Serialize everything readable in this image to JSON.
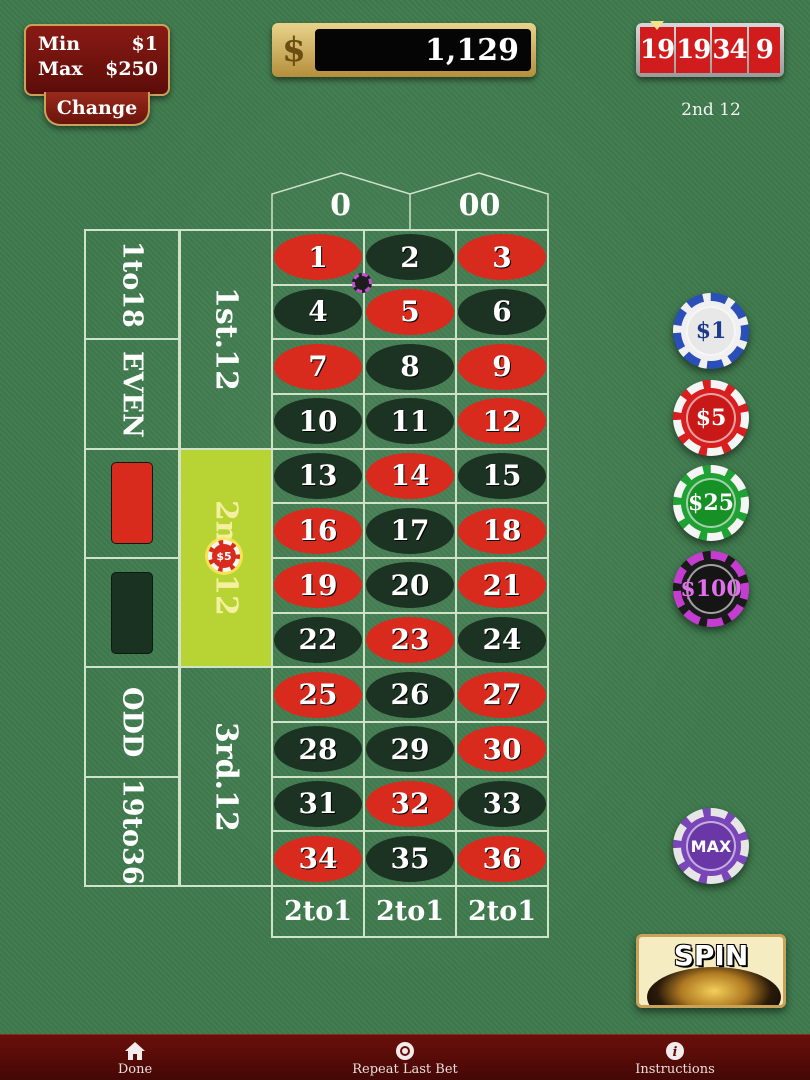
{
  "limits": {
    "min_label": "Min",
    "min_value": "$1",
    "max_label": "Max",
    "max_value": "$250",
    "change_label": "Change"
  },
  "balance": {
    "symbol": "$",
    "amount": "1,129"
  },
  "history": {
    "results": [
      "19",
      "19",
      "34",
      "9"
    ],
    "last_bet": "2nd 12"
  },
  "table": {
    "zero": "0",
    "double_zero": "00",
    "numbers": [
      {
        "n": "1",
        "c": "red"
      },
      {
        "n": "2",
        "c": "black"
      },
      {
        "n": "3",
        "c": "red"
      },
      {
        "n": "4",
        "c": "black"
      },
      {
        "n": "5",
        "c": "red"
      },
      {
        "n": "6",
        "c": "black"
      },
      {
        "n": "7",
        "c": "red"
      },
      {
        "n": "8",
        "c": "black"
      },
      {
        "n": "9",
        "c": "red"
      },
      {
        "n": "10",
        "c": "black"
      },
      {
        "n": "11",
        "c": "black"
      },
      {
        "n": "12",
        "c": "red"
      },
      {
        "n": "13",
        "c": "black"
      },
      {
        "n": "14",
        "c": "red"
      },
      {
        "n": "15",
        "c": "black"
      },
      {
        "n": "16",
        "c": "red"
      },
      {
        "n": "17",
        "c": "black"
      },
      {
        "n": "18",
        "c": "red"
      },
      {
        "n": "19",
        "c": "red"
      },
      {
        "n": "20",
        "c": "black"
      },
      {
        "n": "21",
        "c": "red"
      },
      {
        "n": "22",
        "c": "black"
      },
      {
        "n": "23",
        "c": "red"
      },
      {
        "n": "24",
        "c": "black"
      },
      {
        "n": "25",
        "c": "red"
      },
      {
        "n": "26",
        "c": "black"
      },
      {
        "n": "27",
        "c": "red"
      },
      {
        "n": "28",
        "c": "black"
      },
      {
        "n": "29",
        "c": "black"
      },
      {
        "n": "30",
        "c": "red"
      },
      {
        "n": "31",
        "c": "black"
      },
      {
        "n": "32",
        "c": "red"
      },
      {
        "n": "33",
        "c": "black"
      },
      {
        "n": "34",
        "c": "red"
      },
      {
        "n": "35",
        "c": "black"
      },
      {
        "n": "36",
        "c": "red"
      }
    ],
    "columns": [
      "2to1",
      "2to1",
      "2to1"
    ],
    "dozens": [
      "1st.12",
      "2nd.12",
      "3rd.12"
    ],
    "outside": {
      "low": "1to18",
      "even": "EVEN",
      "odd": "ODD",
      "high": "19to36"
    },
    "bet_chip_value": "$5"
  },
  "chips": {
    "one": "$1",
    "five": "$5",
    "twenty_five": "$25",
    "hundred": "$100",
    "max": "MAX"
  },
  "spin_label": "SPIN",
  "bottom_bar": {
    "done": "Done",
    "repeat": "Repeat Last Bet",
    "instructions": "Instructions"
  },
  "colors": {
    "felt": "#3f7a4e",
    "red": "#d92b1d",
    "black": "#1c3324",
    "highlight": "#b7d334",
    "bar": "#5a0c08"
  }
}
